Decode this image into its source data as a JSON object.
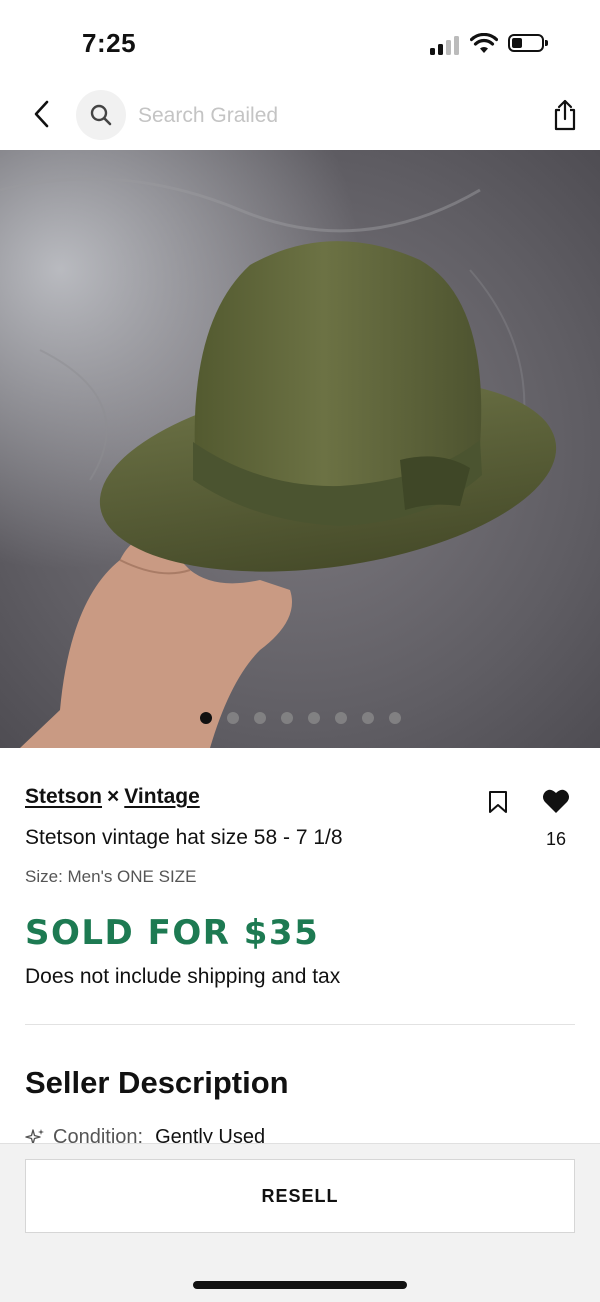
{
  "status_bar": {
    "time": "7:25"
  },
  "search": {
    "placeholder": "Search Grailed"
  },
  "gallery": {
    "image_count": 8,
    "active_index": 0
  },
  "product": {
    "brand_1": "Stetson",
    "separator": "×",
    "brand_2": "Vintage",
    "title": "Stetson vintage hat size 58 - 7 1/8",
    "size": "Size: Men's ONE SIZE",
    "like_count": "16",
    "sold_label": "SOLD FOR $35",
    "shipping_note": "Does not include shipping and tax",
    "price_color": "#1d7a52"
  },
  "seller_description": {
    "heading": "Seller Description",
    "condition_label": "Condition:",
    "condition_value": "Gently Used"
  },
  "footer": {
    "resell_label": "RESELL"
  },
  "icons": {
    "back": "chevron-left-icon",
    "search": "search-icon",
    "share": "share-icon",
    "bookmark": "bookmark-icon",
    "like": "heart-icon",
    "condition": "sparkle-icon"
  }
}
